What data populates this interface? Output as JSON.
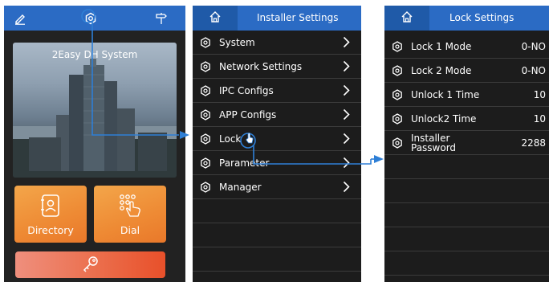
{
  "home": {
    "system_name": "2Easy DH System",
    "tiles": [
      {
        "label": "Directory",
        "icon": "contact-book-icon"
      },
      {
        "label": "Dial",
        "icon": "keypad-touch-icon"
      }
    ],
    "top_icons": [
      "pen-icon",
      "gear-icon",
      "signpost-icon"
    ],
    "unlock_icon": "key-icon"
  },
  "installer": {
    "title": "Installer Settings",
    "items": [
      {
        "label": "System"
      },
      {
        "label": "Network Settings"
      },
      {
        "label": "IPC Configs"
      },
      {
        "label": "APP Configs"
      },
      {
        "label": "Lock"
      },
      {
        "label": "Parameter"
      },
      {
        "label": "Manager"
      }
    ]
  },
  "lock": {
    "title": "Lock Settings",
    "items": [
      {
        "label": "Lock 1 Mode",
        "value": "0-NO"
      },
      {
        "label": "Lock 2 Mode",
        "value": "0-NO"
      },
      {
        "label": "Unlock 1 Time",
        "value": "10"
      },
      {
        "label": "Unlock2 Time",
        "value": "10"
      },
      {
        "label_line1": "Installer",
        "label_line2": "Password",
        "value": "2288"
      }
    ]
  },
  "colors": {
    "header_blue": "#2b6bc4",
    "connector_blue": "#2e7fd6",
    "tile_orange": "#ee8a34",
    "key_red": "#e8502a"
  }
}
